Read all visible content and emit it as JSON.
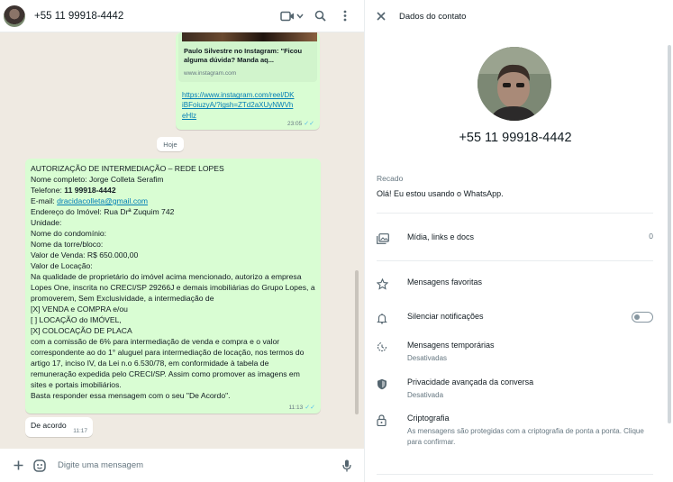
{
  "chat": {
    "contact": "+55 11 99918-4442",
    "link_preview": {
      "title": "Paulo Silvestre no Instagram: \"Ficou alguma dúvida? Manda aq...",
      "domain": "www.instagram.com",
      "url": "https://www.instagram.com/reel/DKiBFoiuzyA/?igsh=ZTd2aXUyNWVheHlz",
      "time": "23:05"
    },
    "date_chip": "Hoje",
    "main_message": {
      "lines": [
        "AUTORIZAÇÃO DE INTERMEDIAÇÃO – REDE LOPES",
        "Nome completo: Jorge Colleta Serafim",
        "Telefone: ",
        "E-mail: ",
        "Endereço do Imóvel: Rua Drª Zuquim 742",
        "Unidade:",
        "Nome do condomínio:",
        "Nome da torre/bloco:",
        "Valor de Venda: R$ 650.000,00",
        "Valor de Locação:",
        "Na qualidade de proprietário do imóvel acima mencionado, autorizo a empresa Lopes One, inscrita no CRECI/SP 29266J e demais imobiliárias do Grupo Lopes, a promoverem, Sem Exclusividade, a intermediação de",
        "[X] VENDA e COMPRA e/ou",
        "[ ] LOCAÇÃO do IMÓVEL,",
        "[X] COLOCAÇÃO DE PLACA",
        "com a comissão de 6% para intermediação de venda e compra e o valor correspondente ao do 1° aluguel para intermediação de locação, nos termos do artigo 17, inciso IV, da Lei n.o 6.530/78, em conformidade à tabela de remuneração expedida pelo CRECI/SP. Assim como promover as imagens em sites e portais imobiliários.",
        "Basta responder essa mensagem com o seu \"De Acordo\"."
      ],
      "phone": "11 99918-4442",
      "email": "dracidacolleta@gmail.com",
      "time": "11:13"
    },
    "reply": {
      "text": "De acordo",
      "time": "11:17"
    },
    "composer_placeholder": "Digite uma mensagem"
  },
  "info": {
    "title": "Dados do contato",
    "name": "+55 11 99918-4442",
    "recado_label": "Recado",
    "recado_text": "Olá! Eu estou usando o WhatsApp.",
    "media_label": "Mídia, links e docs",
    "media_count": "0",
    "favorites_label": "Mensagens favoritas",
    "mute_label": "Silenciar notificações",
    "temporary_label": "Mensagens temporárias",
    "temporary_sub": "Desativadas",
    "privacy_label": "Privacidade avançada da conversa",
    "privacy_sub": "Desativada",
    "crypto_label": "Criptografia",
    "crypto_sub": "As mensagens são protegidas com a criptografia de ponta a ponta. Clique para confirmar."
  }
}
